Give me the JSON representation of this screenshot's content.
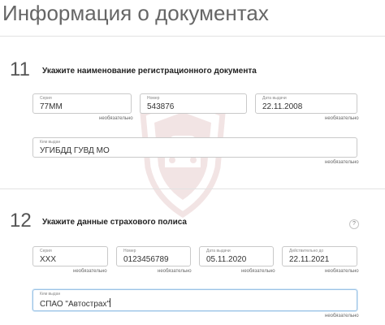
{
  "header": {
    "title": "Информация о документах"
  },
  "sections": [
    {
      "number": "11",
      "heading": "Укажите наименование регистрационного документа",
      "fields": [
        {
          "label": "Серия",
          "value": "77ММ",
          "note": "необязательно"
        },
        {
          "label": "Номер",
          "value": "543876",
          "note": ""
        },
        {
          "label": "Дата выдачи",
          "value": "22.11.2008",
          "note": "необязательно"
        },
        {
          "label": "Кем выдан",
          "value": "УГИБДД ГУВД МО",
          "note": "необязательно"
        }
      ]
    },
    {
      "number": "12",
      "heading": "Укажите данные страхового полиса",
      "help_icon": "?",
      "fields": [
        {
          "label": "Серия",
          "value": "ХХХ",
          "note": "необязательно"
        },
        {
          "label": "Номер",
          "value": "0123456789",
          "note": "необязательно"
        },
        {
          "label": "Дата выдачи",
          "value": "05.11.2020",
          "note": "необязательно"
        },
        {
          "label": "Действительно до",
          "value": "22.11.2021",
          "note": "необязательно"
        },
        {
          "label": "Кем выдан",
          "value": "СПАО \"Автострах\"",
          "note": "необязательно"
        }
      ]
    }
  ],
  "icons": {
    "watermark": "shield-car-icon",
    "help": "question-icon"
  },
  "colors": {
    "field_border": "#c9c9c9",
    "active_field_border": "#9cc3e5",
    "watermark": "#a33a3a"
  }
}
